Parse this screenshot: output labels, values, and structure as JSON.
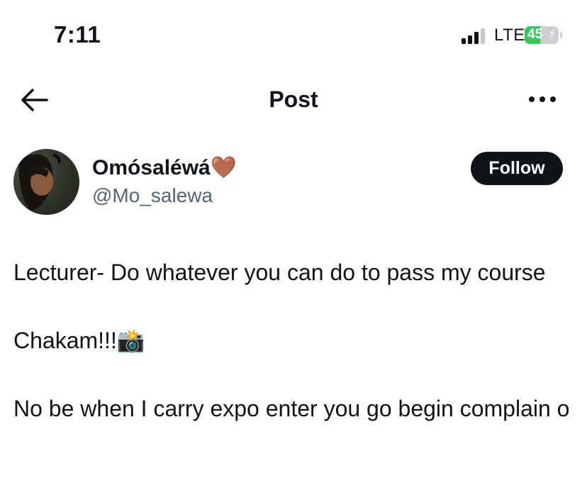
{
  "status_bar": {
    "time": "7:11",
    "network": "LTE",
    "battery_percent": 45,
    "battery_label": "45",
    "colors": {
      "battery_fill": "#35c759",
      "battery_empty": "#cfcfd3"
    }
  },
  "header": {
    "title": "Post",
    "back_icon": "arrow-left-icon",
    "more_icon": "more-horizontal-icon"
  },
  "author": {
    "display_name": "Omósaléwá🤎",
    "handle": "@Mo_salewa",
    "follow_label": "Follow"
  },
  "post": {
    "lines": [
      "Lecturer- Do whatever you can do to pass my course",
      "Chakam!!!📸",
      "No be when I carry expo enter you go begin complain o"
    ]
  }
}
